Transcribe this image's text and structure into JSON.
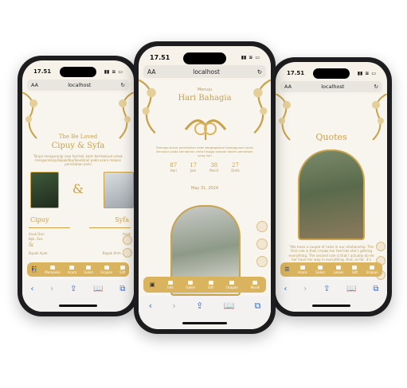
{
  "left_phone": {
    "time": "17.51",
    "aa_label": "AA",
    "url": "localhost",
    "heading": "The Be Loved",
    "couple_title": "Cipuy & Syfa",
    "intro_text": "Tanpa mengurangi rasa hormat, kami bermaksud untuk mengundang Bapak/Ibu/Saudara/i pada acara resepsi pernikahan kami",
    "groom_name": "Cipuy",
    "bride_name": "Syfa",
    "amp": "&",
    "groom_child": "Anak Dari",
    "groom_parents_1": "Bpk. Xxx",
    "groom_parents_2": "&",
    "groom_parents_3": "Ibu Xxx",
    "groom_address": "Bapak Ayah",
    "bride_child": "Anak",
    "bride_parents_1": "Ibu",
    "bride_address": "Bapak Ahm. Ayah",
    "nav": [
      "",
      "Mempelai",
      "Acara",
      "Galeri",
      "Ucapan",
      "Gift"
    ]
  },
  "center_phone": {
    "time": "17.51",
    "aa_label": "AA",
    "url": "localhost",
    "pre_title": "Menuju",
    "title": "Hari Bahagia",
    "verse": "Semoga acara pernikahan kami bergegaskan keanggunan serta tersusun pada keindahan cinta hingga sampai dalam penantian yang hari",
    "countdown": [
      {
        "num": "87",
        "label": "Hari"
      },
      {
        "num": "17",
        "label": "Jam"
      },
      {
        "num": "38",
        "label": "Menit"
      },
      {
        "num": "27",
        "label": "Detik"
      }
    ],
    "date": "May 31, 2024",
    "nav": [
      "",
      "Info",
      "Galeri",
      "Gift",
      "Ucapan",
      "Musik"
    ]
  },
  "right_phone": {
    "time": "17.51",
    "aa_label": "AA",
    "url": "localhost",
    "title": "Quotes",
    "quote": "“We have a couple of rules in our relationship. The first rule is that I make her feel like she’s getting everything. The second rule is that I actually do let her have her way in everything. And, so far, it’s working.” – Justin Timberlake",
    "nav": [
      "",
      "Acara",
      "Galeri",
      "Lokasi",
      "Gift",
      "Ucapan"
    ]
  },
  "colors": {
    "gold": "#c9a24a",
    "nav_gold": "#d9b35e",
    "paper": "#f8f5ef",
    "phone": "#1d1d1f"
  }
}
